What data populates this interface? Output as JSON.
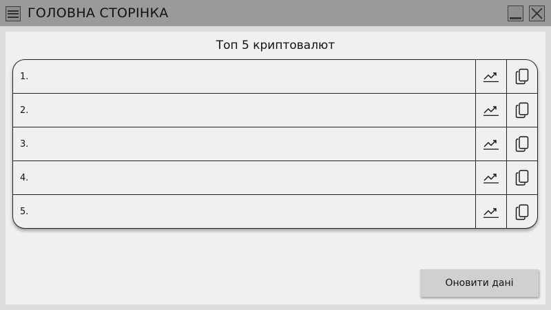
{
  "window": {
    "title": "ГОЛОВНА СТОРІНКА",
    "menu_icon": "hamburger-icon",
    "minimize_icon": "minimize-icon",
    "close_icon": "close-icon"
  },
  "main": {
    "heading": "Топ 5 криптовалют",
    "rows": [
      {
        "label": "1.",
        "chart_icon": "trending-up-icon",
        "copy_icon": "copy-icon"
      },
      {
        "label": "2.",
        "chart_icon": "trending-up-icon",
        "copy_icon": "copy-icon"
      },
      {
        "label": "3.",
        "chart_icon": "trending-up-icon",
        "copy_icon": "copy-icon"
      },
      {
        "label": "4.",
        "chart_icon": "trending-up-icon",
        "copy_icon": "copy-icon"
      },
      {
        "label": "5.",
        "chart_icon": "trending-up-icon",
        "copy_icon": "copy-icon"
      }
    ],
    "refresh_label": "Оновити дані"
  }
}
